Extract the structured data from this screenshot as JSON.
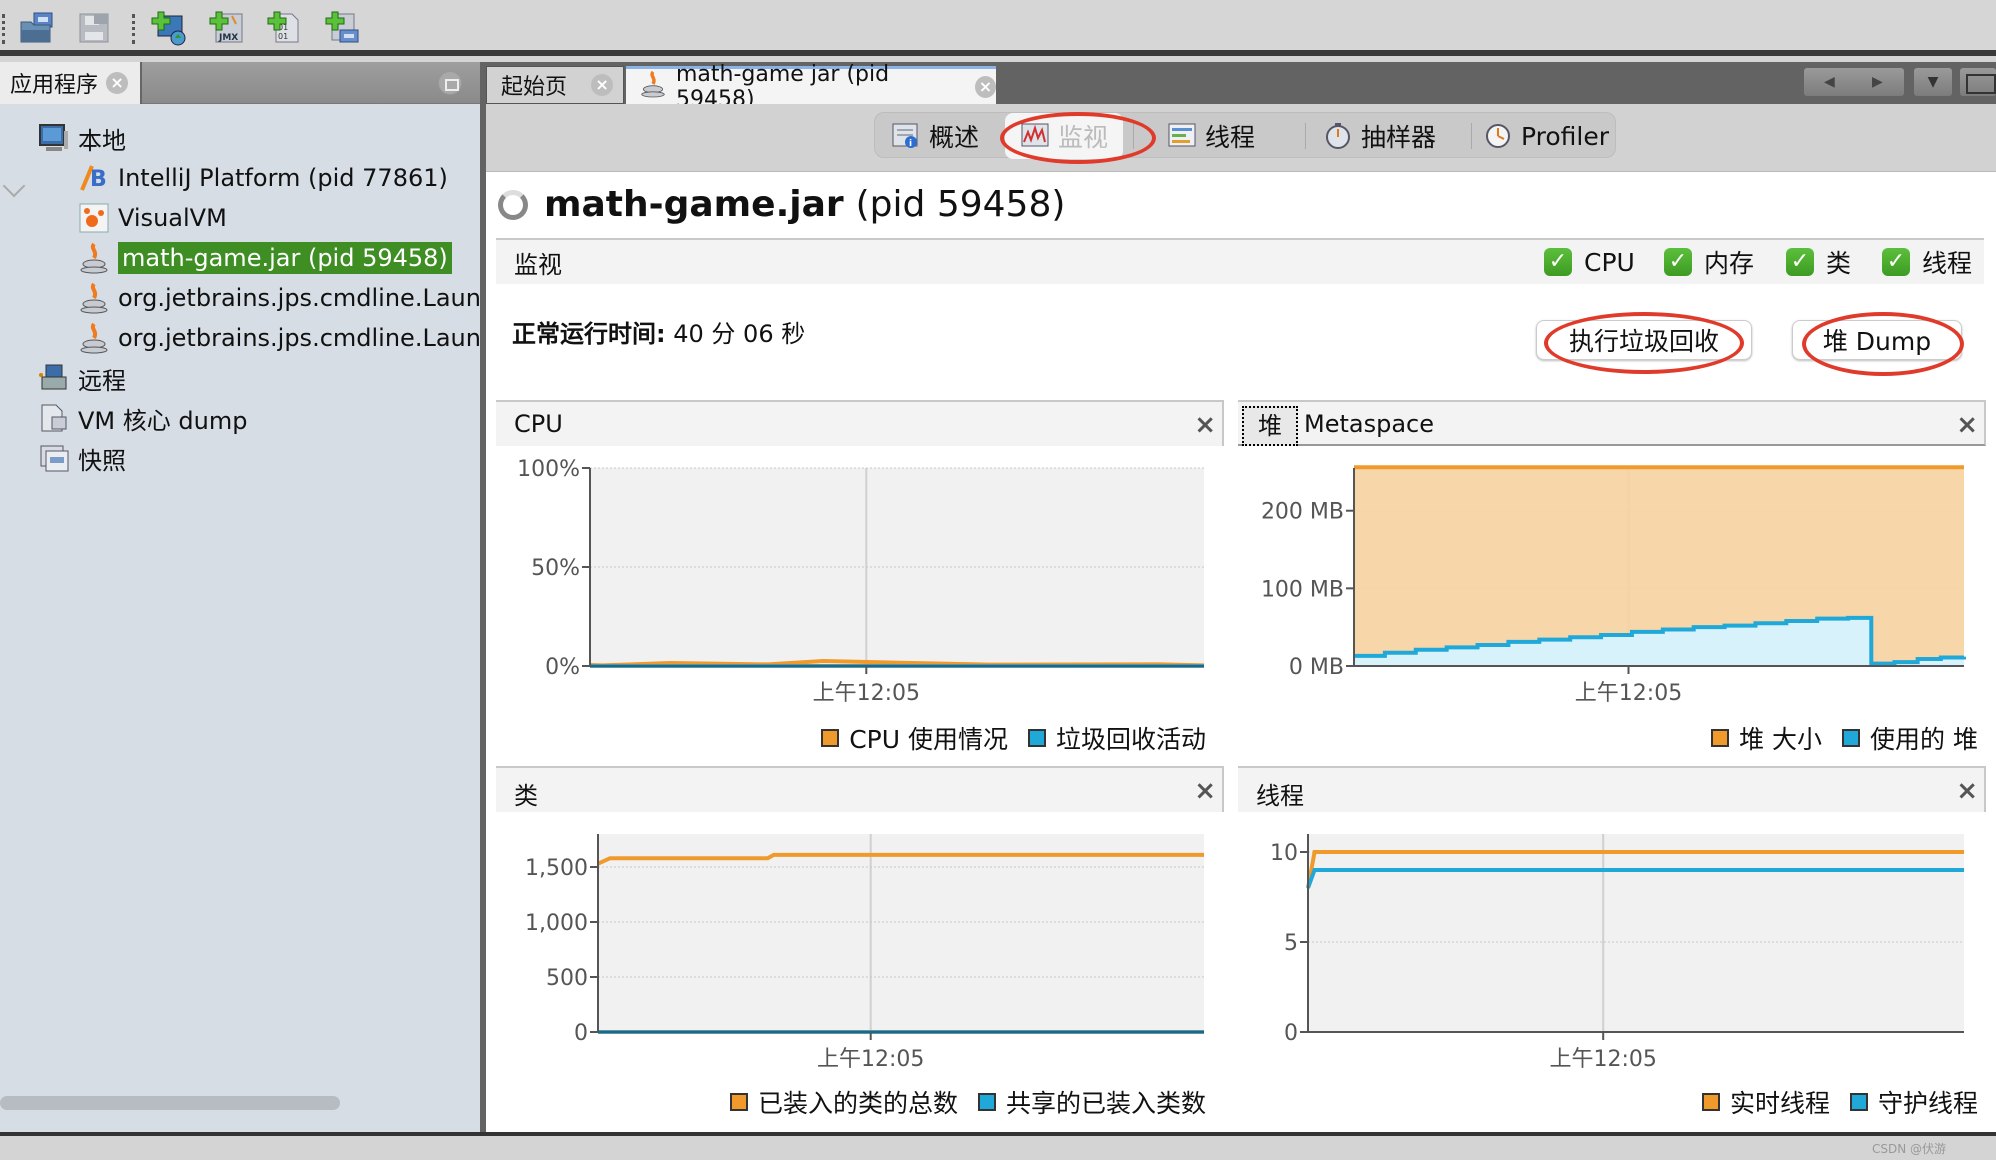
{
  "toolbar": {
    "buttons": [
      {
        "name": "load-application-snapshot",
        "icon": "open-folder-icon"
      },
      {
        "name": "save",
        "icon": "save-icon"
      },
      {
        "name": "add-remote-host",
        "icon": "add-remote-host-icon"
      },
      {
        "name": "add-jmx-connection",
        "icon": "add-jmx-icon"
      },
      {
        "name": "add-vm-coredump",
        "icon": "add-coredump-icon"
      },
      {
        "name": "add-snapshot",
        "icon": "add-snapshot-icon"
      }
    ]
  },
  "left_panel": {
    "tab_label": "应用程序",
    "tree": [
      {
        "label": "本地",
        "icon": "local-host-icon",
        "level": 0,
        "expanded": true
      },
      {
        "label": "IntelliJ Platform (pid 77861)",
        "icon": "intellij-icon",
        "level": 1
      },
      {
        "label": "VisualVM",
        "icon": "visualvm-icon",
        "level": 1
      },
      {
        "label": "math-game.jar (pid 59458)",
        "icon": "java-icon",
        "level": 1,
        "selected": true
      },
      {
        "label": "org.jetbrains.jps.cmdline.Launcher",
        "icon": "java-icon",
        "level": 1
      },
      {
        "label": "org.jetbrains.jps.cmdline.Launcher",
        "icon": "java-icon",
        "level": 1
      },
      {
        "label": "远程",
        "icon": "remote-host-icon",
        "level": 0
      },
      {
        "label": "VM 核心 dump",
        "icon": "coredump-icon",
        "level": 0
      },
      {
        "label": "快照",
        "icon": "snapshot-icon",
        "level": 0
      }
    ]
  },
  "doc_tabs": [
    {
      "label": "起始页",
      "active": false
    },
    {
      "label": "math-game jar (pid 59458)",
      "active": true
    }
  ],
  "sub_tabs": [
    {
      "label": "概述",
      "icon": "overview-icon"
    },
    {
      "label": "监视",
      "icon": "monitor-icon",
      "active": true
    },
    {
      "label": "线程",
      "icon": "threads-icon"
    },
    {
      "label": "抽样器",
      "icon": "sampler-icon"
    },
    {
      "label": "Profiler",
      "icon": "profiler-icon"
    }
  ],
  "page": {
    "app_name": "math-game.jar",
    "pid_text": "(pid 59458)",
    "monitor_title": "监视",
    "checkboxes": [
      {
        "label": "CPU",
        "checked": true
      },
      {
        "label": "内存",
        "checked": true
      },
      {
        "label": "类",
        "checked": true
      },
      {
        "label": "线程",
        "checked": true
      }
    ],
    "uptime_label": "正常运行时间:",
    "uptime_value": "40 分 06 秒",
    "gc_button": "执行垃圾回收",
    "heap_dump_button": "堆 Dump"
  },
  "panels": {
    "cpu": {
      "title": "CPU",
      "close": "×"
    },
    "heap": {
      "tab_heap": "堆",
      "tab_metaspace": "Metaspace",
      "close": "×"
    },
    "classes": {
      "title": "类",
      "close": "×"
    },
    "threads": {
      "title": "线程",
      "close": "×"
    }
  },
  "colors": {
    "orange": "#f09a2c",
    "blue": "#1fa8d8",
    "selected_green": "#3e8e24",
    "annotation_red": "#e03a2a"
  },
  "chart_data": [
    {
      "type": "line",
      "title": "CPU",
      "xlabel": "",
      "ylabel": "",
      "x_ticks": [
        "上午12:05"
      ],
      "y_ticks": [
        "0%",
        "50%",
        "100%"
      ],
      "ylim": [
        0,
        100
      ],
      "grid": true,
      "legend": "bottom-right",
      "series": [
        {
          "name": "CPU 使用情况",
          "color": "#f09a2c",
          "x": [
            0,
            0.02,
            0.13,
            0.29,
            0.38,
            0.65,
            0.93,
            1
          ],
          "values": [
            0.5,
            0.3,
            1.5,
            0.8,
            2.5,
            0.7,
            0.8,
            0.3
          ]
        },
        {
          "name": "垃圾回收活动",
          "color": "#1fa8d8",
          "x": [
            0,
            1
          ],
          "values": [
            0,
            0
          ]
        }
      ]
    },
    {
      "type": "area",
      "title": "堆",
      "x_ticks": [
        "上午12:05"
      ],
      "y_ticks": [
        "0 MB",
        "100 MB",
        "200 MB"
      ],
      "ylim": [
        0,
        255
      ],
      "grid": true,
      "legend": "bottom-right",
      "series": [
        {
          "name": "堆 大小",
          "color": "#f09a2c",
          "x": [
            0,
            1
          ],
          "values": [
            256,
            256
          ]
        },
        {
          "name": "使用的 堆",
          "color": "#1fa8d8",
          "x": [
            0,
            0.04,
            0.11,
            0.17,
            0.25,
            0.34,
            0.41,
            0.46,
            0.54,
            0.61,
            0.66,
            0.74,
            0.81,
            0.87,
            0.92,
            0.96,
            1
          ],
          "values": [
            13,
            17,
            21,
            24,
            27,
            31,
            34,
            37,
            40,
            44,
            47,
            50,
            52,
            55,
            58,
            61,
            62,
            3,
            5,
            9,
            11,
            12
          ]
        }
      ]
    },
    {
      "type": "line",
      "title": "类",
      "x_ticks": [
        "上午12:05"
      ],
      "y_ticks": [
        "0",
        "500",
        "1,000",
        "1,500"
      ],
      "ylim": [
        0,
        1800
      ],
      "grid": true,
      "legend": "bottom-right",
      "series": [
        {
          "name": "已装入的类的总数",
          "color": "#f09a2c",
          "x": [
            0,
            0.02,
            0.28,
            0.29,
            1
          ],
          "values": [
            1530,
            1580,
            1580,
            1610,
            1610
          ]
        },
        {
          "name": "共享的已装入类数",
          "color": "#1fa8d8",
          "x": [
            0,
            1
          ],
          "values": [
            0,
            0
          ]
        }
      ]
    },
    {
      "type": "line",
      "title": "线程",
      "x_ticks": [
        "上午12:05"
      ],
      "y_ticks": [
        "0",
        "5",
        "10"
      ],
      "ylim": [
        0,
        11
      ],
      "grid": true,
      "legend": "bottom-right",
      "series": [
        {
          "name": "实时线程",
          "color": "#f09a2c",
          "x": [
            0,
            0.01,
            1
          ],
          "values": [
            8,
            10,
            10
          ]
        },
        {
          "name": "守护线程",
          "color": "#1fa8d8",
          "x": [
            0,
            0.01,
            1
          ],
          "values": [
            8,
            9,
            9
          ]
        }
      ]
    }
  ],
  "watermark": "CSDN @伏游"
}
